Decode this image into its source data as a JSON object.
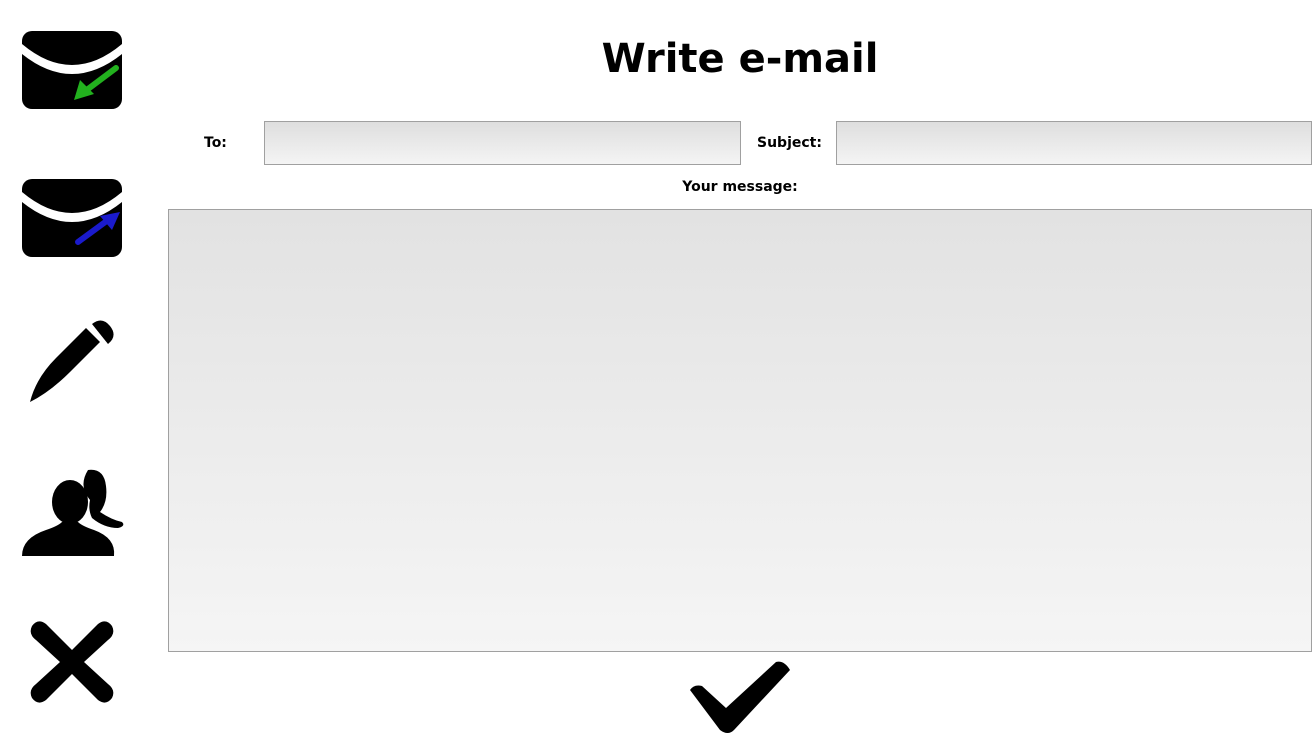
{
  "page": {
    "title": "Write e-mail"
  },
  "nav": [
    {
      "id": "inbox",
      "icon": "mail-inbox-icon"
    },
    {
      "id": "sent",
      "icon": "mail-sent-icon"
    },
    {
      "id": "compose",
      "icon": "pencil-icon"
    },
    {
      "id": "contacts",
      "icon": "contacts-icon"
    },
    {
      "id": "close",
      "icon": "close-icon"
    }
  ],
  "form": {
    "to_label": "To:",
    "to_value": "",
    "subject_label": "Subject:",
    "subject_value": "",
    "message_label": "Your message:",
    "message_value": "",
    "send_icon": "checkmark-icon"
  },
  "colors": {
    "inbox_arrow": "#22b11e",
    "sent_arrow": "#1a1acc",
    "icon": "#000000",
    "field_border": "#a0a0a0"
  }
}
